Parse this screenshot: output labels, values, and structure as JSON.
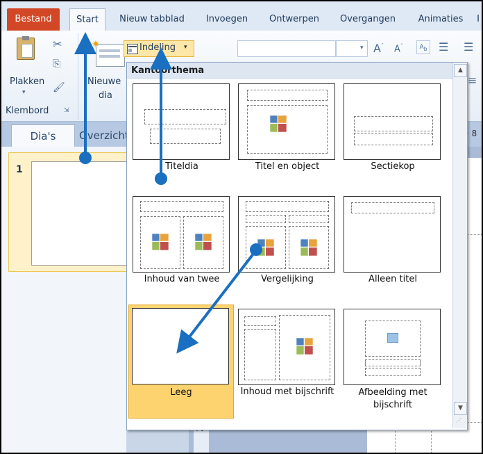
{
  "tabs": [
    {
      "label": "Bestand"
    },
    {
      "label": "Start"
    },
    {
      "label": "Nieuw tabblad"
    },
    {
      "label": "Invoegen"
    },
    {
      "label": "Ontwerpen"
    },
    {
      "label": "Overgangen"
    },
    {
      "label": "Animaties"
    }
  ],
  "ribbon": {
    "paste_label": "Plakken",
    "new_slide_label_1": "Nieuwe",
    "new_slide_label_2": "dia",
    "clipboard_group": "Klembord",
    "layout_button": "Indeling"
  },
  "panel_tabs": {
    "slides": "Dia's",
    "outline": "Overzicht"
  },
  "thumbnails": {
    "slide_number": "1"
  },
  "ruler": {
    "h_mark": "· 8",
    "v_mark": "2 ·"
  },
  "dropdown": {
    "header": "Kantoorthema",
    "layouts": [
      {
        "name": "Titeldia"
      },
      {
        "name": "Titel en object"
      },
      {
        "name": "Sectiekop"
      },
      {
        "name": "Inhoud van twee"
      },
      {
        "name": "Vergelijking"
      },
      {
        "name": "Alleen titel"
      },
      {
        "name": "Leeg",
        "selected": true
      },
      {
        "name": "Inhoud met bijschrift"
      },
      {
        "name": "Afbeelding met bijschrift"
      }
    ]
  },
  "colors": {
    "file_tab": "#d24726",
    "arrow": "#1a6fc0",
    "selected": "#fdd36f"
  }
}
